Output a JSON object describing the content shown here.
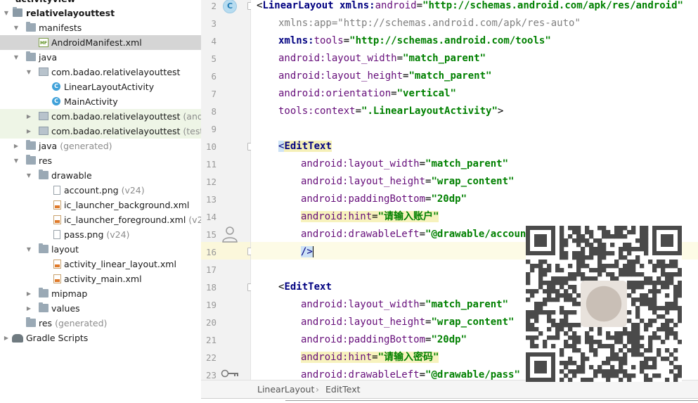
{
  "tree": {
    "top_partial": "activityview",
    "root": "relativelayouttest",
    "items": [
      {
        "label": "manifests"
      },
      {
        "label": "AndroidManifest.xml",
        "icon_text": "MF"
      },
      {
        "label": "java"
      },
      {
        "label": "com.badao.relativelayouttest"
      },
      {
        "label": "LinearLayoutActivity",
        "icon_text": "C"
      },
      {
        "label": "MainActivity",
        "icon_text": "C"
      },
      {
        "label": "com.badao.relativelayouttest",
        "suffix": "(androi"
      },
      {
        "label": "com.badao.relativelayouttest",
        "suffix": "(test)"
      },
      {
        "label": "java",
        "suffix": "(generated)"
      },
      {
        "label": "res"
      },
      {
        "label": "drawable"
      },
      {
        "label": "account.png",
        "suffix": "(v24)"
      },
      {
        "label": "ic_launcher_background.xml"
      },
      {
        "label": "ic_launcher_foreground.xml",
        "suffix": "(v24)"
      },
      {
        "label": "pass.png",
        "suffix": "(v24)"
      },
      {
        "label": "layout"
      },
      {
        "label": "activity_linear_layout.xml"
      },
      {
        "label": "activity_main.xml"
      },
      {
        "label": "mipmap"
      },
      {
        "label": "values"
      },
      {
        "label": "res",
        "suffix": "(generated)"
      },
      {
        "label": "Gradle Scripts"
      }
    ]
  },
  "editor": {
    "line_numbers": [
      "2",
      "3",
      "4",
      "5",
      "6",
      "7",
      "8",
      "9",
      "10",
      "11",
      "12",
      "13",
      "14",
      "15",
      "16",
      "17",
      "18",
      "19",
      "20",
      "21",
      "22",
      "23"
    ],
    "gutter_badge": "C",
    "lines": {
      "l2": {
        "tag": "LinearLayout",
        "attr_ns": "xmlns:",
        "attr_name": "android",
        "value": "\"http://schemas.android.com/apk/res/android\""
      },
      "l3": {
        "attr": "xmlns:app=",
        "value": "\"http://schemas.android.com/apk/res-auto\""
      },
      "l4": {
        "attr_ns": "xmlns:",
        "attr_name": "tools",
        "value": "\"http://schemas.android.com/tools\""
      },
      "l5": {
        "ns": "android:",
        "name": "layout_width",
        "value": "\"match_parent\""
      },
      "l6": {
        "ns": "android:",
        "name": "layout_height",
        "value": "\"match_parent\""
      },
      "l7": {
        "ns": "android:",
        "name": "orientation",
        "value": "\"vertical\""
      },
      "l8": {
        "ns": "tools:",
        "name": "context",
        "value": "\".LinearLayoutActivity\"",
        "close": ">"
      },
      "l10": {
        "tag": "EditText"
      },
      "l11": {
        "ns": "android:",
        "name": "layout_width",
        "value": "\"match_parent\""
      },
      "l12": {
        "ns": "android:",
        "name": "layout_height",
        "value": "\"wrap_content\""
      },
      "l13": {
        "ns": "android:",
        "name": "paddingBottom",
        "value": "\"20dp\""
      },
      "l14": {
        "ns": "android:",
        "name": "hint",
        "value": "\"请输入账户\""
      },
      "l15": {
        "ns": "android:",
        "name": "drawableLeft",
        "value": "\"@drawable/account\""
      },
      "l16": {
        "close": "/>"
      },
      "l18": {
        "tag": "EditText"
      },
      "l19": {
        "ns": "android:",
        "name": "layout_width",
        "value": "\"match_parent\""
      },
      "l20": {
        "ns": "android:",
        "name": "layout_height",
        "value": "\"wrap_content\""
      },
      "l21": {
        "ns": "android:",
        "name": "paddingBottom",
        "value": "\"20dp\""
      },
      "l22": {
        "ns": "android:",
        "name": "hint",
        "value": "\"请输入密码\""
      },
      "l23": {
        "ns": "android:",
        "name": "drawableLeft",
        "value": "\"@drawable/pass\""
      }
    }
  },
  "breadcrumb": {
    "items": [
      "LinearLayout",
      "EditText"
    ],
    "separator": "›"
  },
  "colors": {
    "tag": "#000080",
    "attr": "#660e7a",
    "value": "#008000",
    "selection": "#d5d5d5",
    "current_line": "#fdfbe6"
  }
}
